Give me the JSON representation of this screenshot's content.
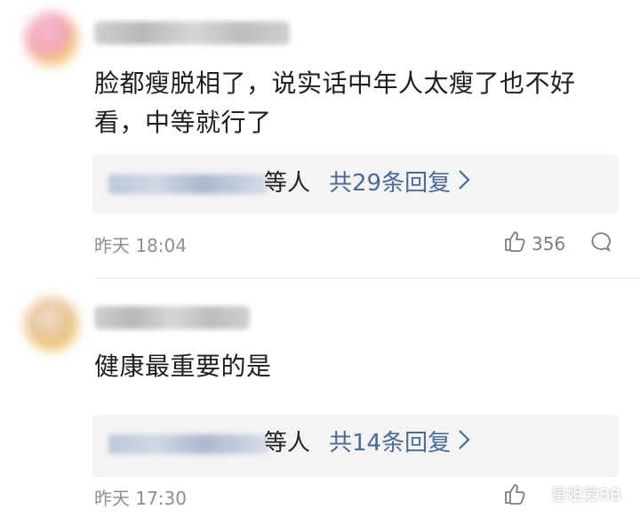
{
  "comments": [
    {
      "username": "**** ** **",
      "text": "脸都瘦脱相了，说实话中年人太瘦了也不好看，中等就行了",
      "reply_names": "**** ****",
      "reply_suffix": "等人",
      "reply_count_label": "共29条回复",
      "timestamp": "昨天 18:04",
      "likes": "356"
    },
    {
      "username": "***** **",
      "text": "健康最重要的是",
      "reply_names": "**** ****",
      "reply_suffix": "等人",
      "reply_count_label": "共14条回复",
      "timestamp": "昨天 17:30",
      "likes": ""
    }
  ],
  "watermark": "星姐爱BB",
  "icons": {
    "like": "thumbs-up-icon",
    "comment": "comment-icon",
    "chevron": "chevron-right-icon",
    "watermark": "wechat-icon"
  },
  "colors": {
    "reply_link": "#4a6a9b",
    "meta": "#8e8e8e",
    "reply_bg": "#f4f4f4"
  }
}
